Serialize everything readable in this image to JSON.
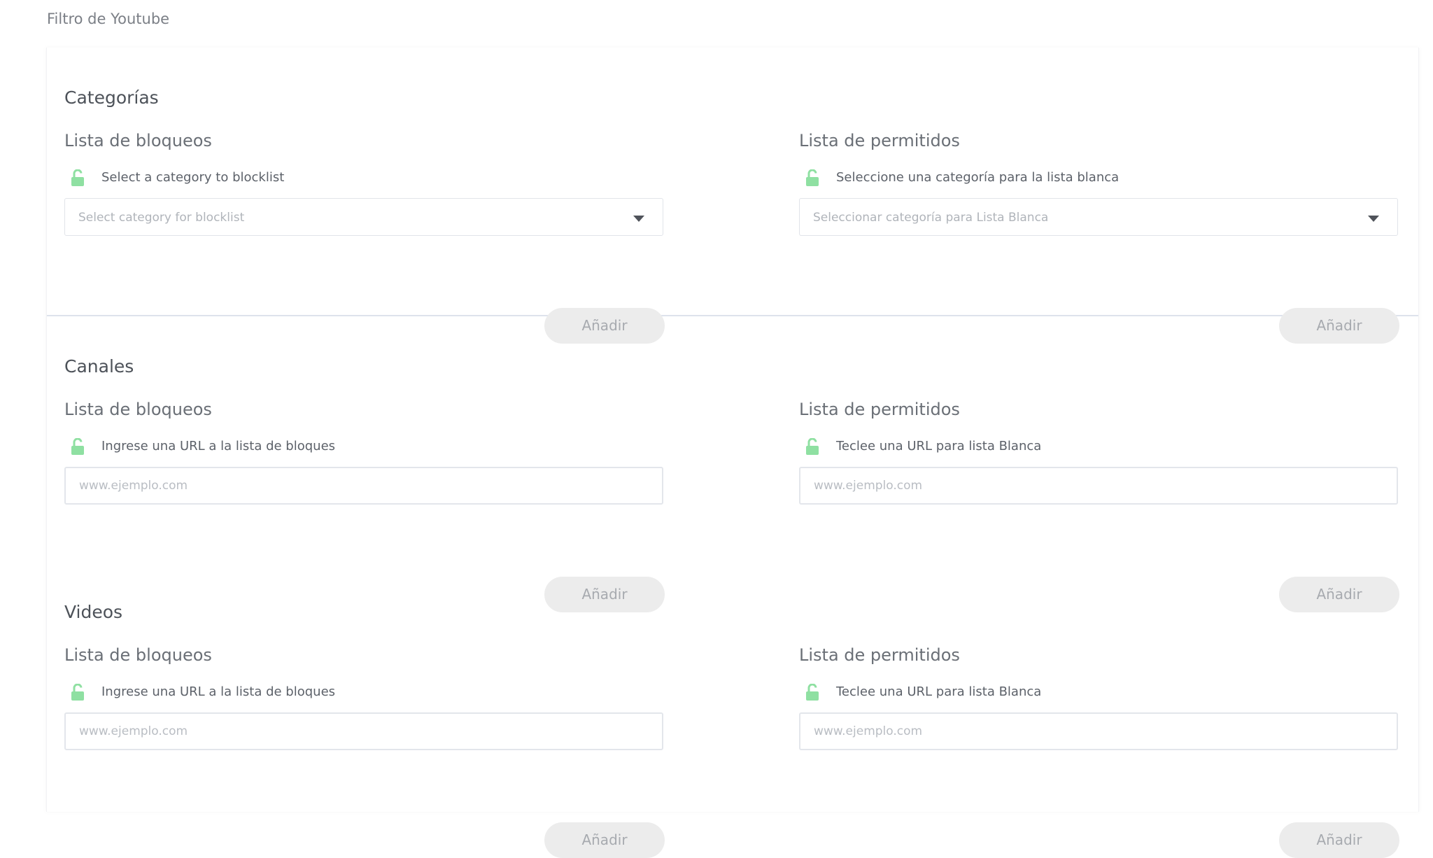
{
  "page": {
    "title": "Filtro de Youtube"
  },
  "colors": {
    "lock_icon": "#8fe0a2",
    "button_bg": "#ececec",
    "button_text": "#a7aaaf",
    "divider": "#dde2ec"
  },
  "categories": {
    "title": "Categorías",
    "blocklist": {
      "title": "Lista de bloqueos",
      "icon": "unlock-icon",
      "label": "Select a category to blocklist",
      "select_placeholder": "Select category for blocklist",
      "button": "Añadir"
    },
    "allowlist": {
      "title": "Lista de permitidos",
      "icon": "unlock-icon",
      "label": "Seleccione una categoría para la lista blanca",
      "select_placeholder": "Seleccionar categoría para Lista Blanca",
      "button": "Añadir"
    }
  },
  "channels": {
    "title": "Canales",
    "blocklist": {
      "title": "Lista de bloqueos",
      "icon": "unlock-icon",
      "label": "Ingrese una URL a la lista de bloques",
      "input_placeholder": "www.ejemplo.com",
      "button": "Añadir"
    },
    "allowlist": {
      "title": "Lista de permitidos",
      "icon": "unlock-icon",
      "label": "Teclee una URL para lista Blanca",
      "input_placeholder": "www.ejemplo.com",
      "button": "Añadir"
    }
  },
  "videos": {
    "title": "Videos",
    "blocklist": {
      "title": "Lista de bloqueos",
      "icon": "unlock-icon",
      "label": "Ingrese una URL a la lista de bloques",
      "input_placeholder": "www.ejemplo.com",
      "button": "Añadir"
    },
    "allowlist": {
      "title": "Lista de permitidos",
      "icon": "unlock-icon",
      "label": "Teclee una URL para lista Blanca",
      "input_placeholder": "www.ejemplo.com",
      "button": "Añadir"
    }
  }
}
